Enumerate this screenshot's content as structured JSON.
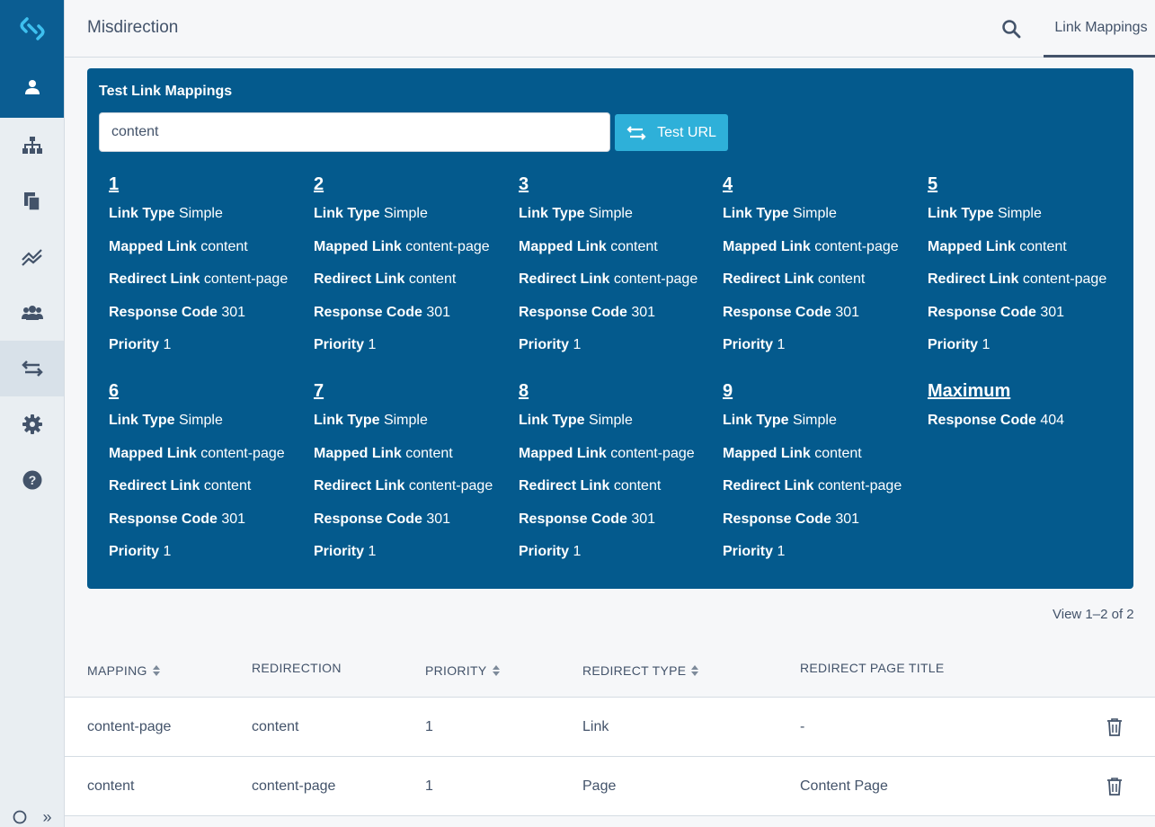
{
  "header": {
    "title": "Misdirection",
    "tab": "Link Mappings"
  },
  "test_panel": {
    "title": "Test Link Mappings",
    "input_value": "content",
    "button_label": "Test URL",
    "results": [
      {
        "num": "1",
        "link_type_label": "Link Type",
        "link_type": "Simple",
        "mapped_label": "Mapped Link",
        "mapped": "content",
        "redirect_label": "Redirect Link",
        "redirect": "content-page",
        "code_label": "Response Code",
        "code": "301",
        "priority_label": "Priority",
        "priority": "1"
      },
      {
        "num": "2",
        "link_type_label": "Link Type",
        "link_type": "Simple",
        "mapped_label": "Mapped Link",
        "mapped": "content-page",
        "redirect_label": "Redirect Link",
        "redirect": "content",
        "code_label": "Response Code",
        "code": "301",
        "priority_label": "Priority",
        "priority": "1"
      },
      {
        "num": "3",
        "link_type_label": "Link Type",
        "link_type": "Simple",
        "mapped_label": "Mapped Link",
        "mapped": "content",
        "redirect_label": "Redirect Link",
        "redirect": "content-page",
        "code_label": "Response Code",
        "code": "301",
        "priority_label": "Priority",
        "priority": "1"
      },
      {
        "num": "4",
        "link_type_label": "Link Type",
        "link_type": "Simple",
        "mapped_label": "Mapped Link",
        "mapped": "content-page",
        "redirect_label": "Redirect Link",
        "redirect": "content",
        "code_label": "Response Code",
        "code": "301",
        "priority_label": "Priority",
        "priority": "1"
      },
      {
        "num": "5",
        "link_type_label": "Link Type",
        "link_type": "Simple",
        "mapped_label": "Mapped Link",
        "mapped": "content",
        "redirect_label": "Redirect Link",
        "redirect": "content-page",
        "code_label": "Response Code",
        "code": "301",
        "priority_label": "Priority",
        "priority": "1"
      },
      {
        "num": "6",
        "link_type_label": "Link Type",
        "link_type": "Simple",
        "mapped_label": "Mapped Link",
        "mapped": "content-page",
        "redirect_label": "Redirect Link",
        "redirect": "content",
        "code_label": "Response Code",
        "code": "301",
        "priority_label": "Priority",
        "priority": "1"
      },
      {
        "num": "7",
        "link_type_label": "Link Type",
        "link_type": "Simple",
        "mapped_label": "Mapped Link",
        "mapped": "content",
        "redirect_label": "Redirect Link",
        "redirect": "content-page",
        "code_label": "Response Code",
        "code": "301",
        "priority_label": "Priority",
        "priority": "1"
      },
      {
        "num": "8",
        "link_type_label": "Link Type",
        "link_type": "Simple",
        "mapped_label": "Mapped Link",
        "mapped": "content-page",
        "redirect_label": "Redirect Link",
        "redirect": "content",
        "code_label": "Response Code",
        "code": "301",
        "priority_label": "Priority",
        "priority": "1"
      },
      {
        "num": "9",
        "link_type_label": "Link Type",
        "link_type": "Simple",
        "mapped_label": "Mapped Link",
        "mapped": "content",
        "redirect_label": "Redirect Link",
        "redirect": "content-page",
        "code_label": "Response Code",
        "code": "301",
        "priority_label": "Priority",
        "priority": "1"
      }
    ],
    "maximum": {
      "title": "Maximum",
      "code_label": "Response Code",
      "code": "404"
    }
  },
  "table": {
    "view_count": "View 1–2 of 2",
    "headers": [
      "MAPPING",
      "REDIRECTION",
      "PRIORITY",
      "REDIRECT TYPE",
      "REDIRECT PAGE TITLE"
    ],
    "rows": [
      {
        "mapping": "content-page",
        "redirection": "content",
        "priority": "1",
        "redirect_type": "Link",
        "page_title": "-"
      },
      {
        "mapping": "content",
        "redirection": "content-page",
        "priority": "1",
        "redirect_type": "Page",
        "page_title": "Content Page"
      }
    ]
  },
  "sidebar": {
    "items": [
      "user-icon",
      "sitemap-icon",
      "pages-icon",
      "chart-line-icon",
      "users-group-icon",
      "redirect-arrows-icon",
      "gear-icon",
      "help-icon"
    ]
  },
  "colors": {
    "brand": "#0b5d92",
    "panel": "#045a8d",
    "accent": "#2eb0d9",
    "text": "#43536a"
  }
}
